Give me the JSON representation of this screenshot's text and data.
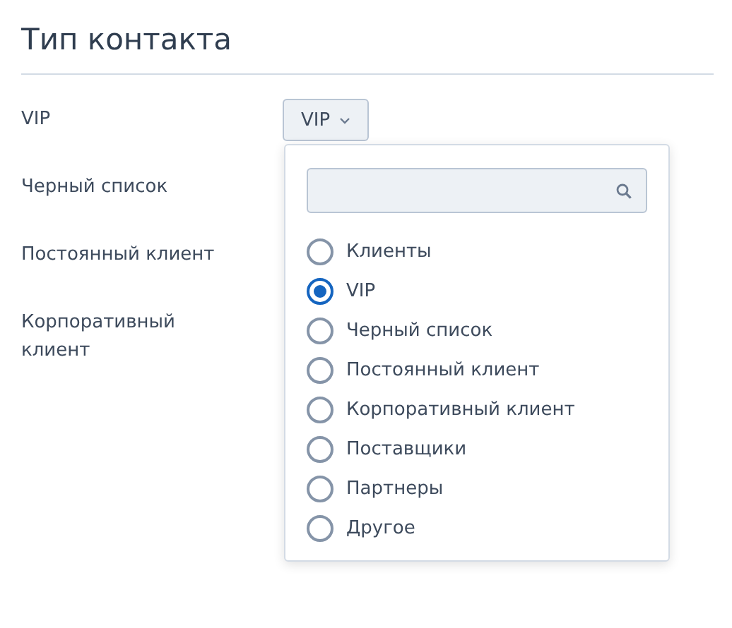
{
  "title": "Тип контакта",
  "fields": [
    {
      "label": "VIP",
      "value": "VIP"
    },
    {
      "label": "Черный список"
    },
    {
      "label": "Постоянный клиент"
    },
    {
      "label": "Корпоративный клиент"
    }
  ],
  "dropdown": {
    "options": [
      {
        "label": "Клиенты",
        "selected": false
      },
      {
        "label": "VIP",
        "selected": true
      },
      {
        "label": "Черный список",
        "selected": false
      },
      {
        "label": "Постоянный клиент",
        "selected": false
      },
      {
        "label": "Корпоративный клиент",
        "selected": false
      },
      {
        "label": "Поставщики",
        "selected": false
      },
      {
        "label": "Партнеры",
        "selected": false
      },
      {
        "label": "Другое",
        "selected": false
      }
    ]
  }
}
